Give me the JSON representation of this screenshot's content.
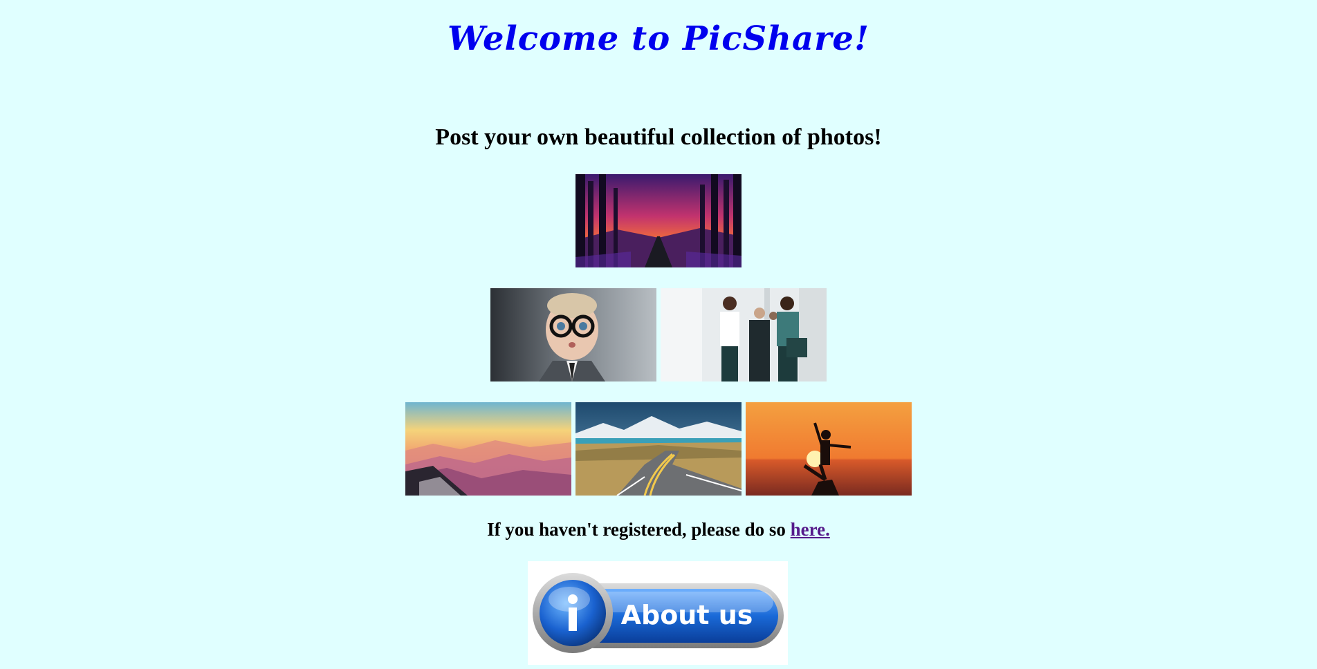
{
  "header": {
    "title": "Welcome to PicShare!"
  },
  "main": {
    "subtitle": "Post your own beautiful collection of photos!",
    "register_text": "If you haven't registered, please do so ",
    "register_link": "here.",
    "about_button_label": "About us",
    "about_icon": "info-icon"
  },
  "photos": [
    {
      "name": "forest-sunset-photo"
    },
    {
      "name": "child-glasses-photo"
    },
    {
      "name": "business-people-photo"
    },
    {
      "name": "mountain-sunrise-photo"
    },
    {
      "name": "mountain-road-photo"
    },
    {
      "name": "silhouette-sunset-photo"
    }
  ]
}
